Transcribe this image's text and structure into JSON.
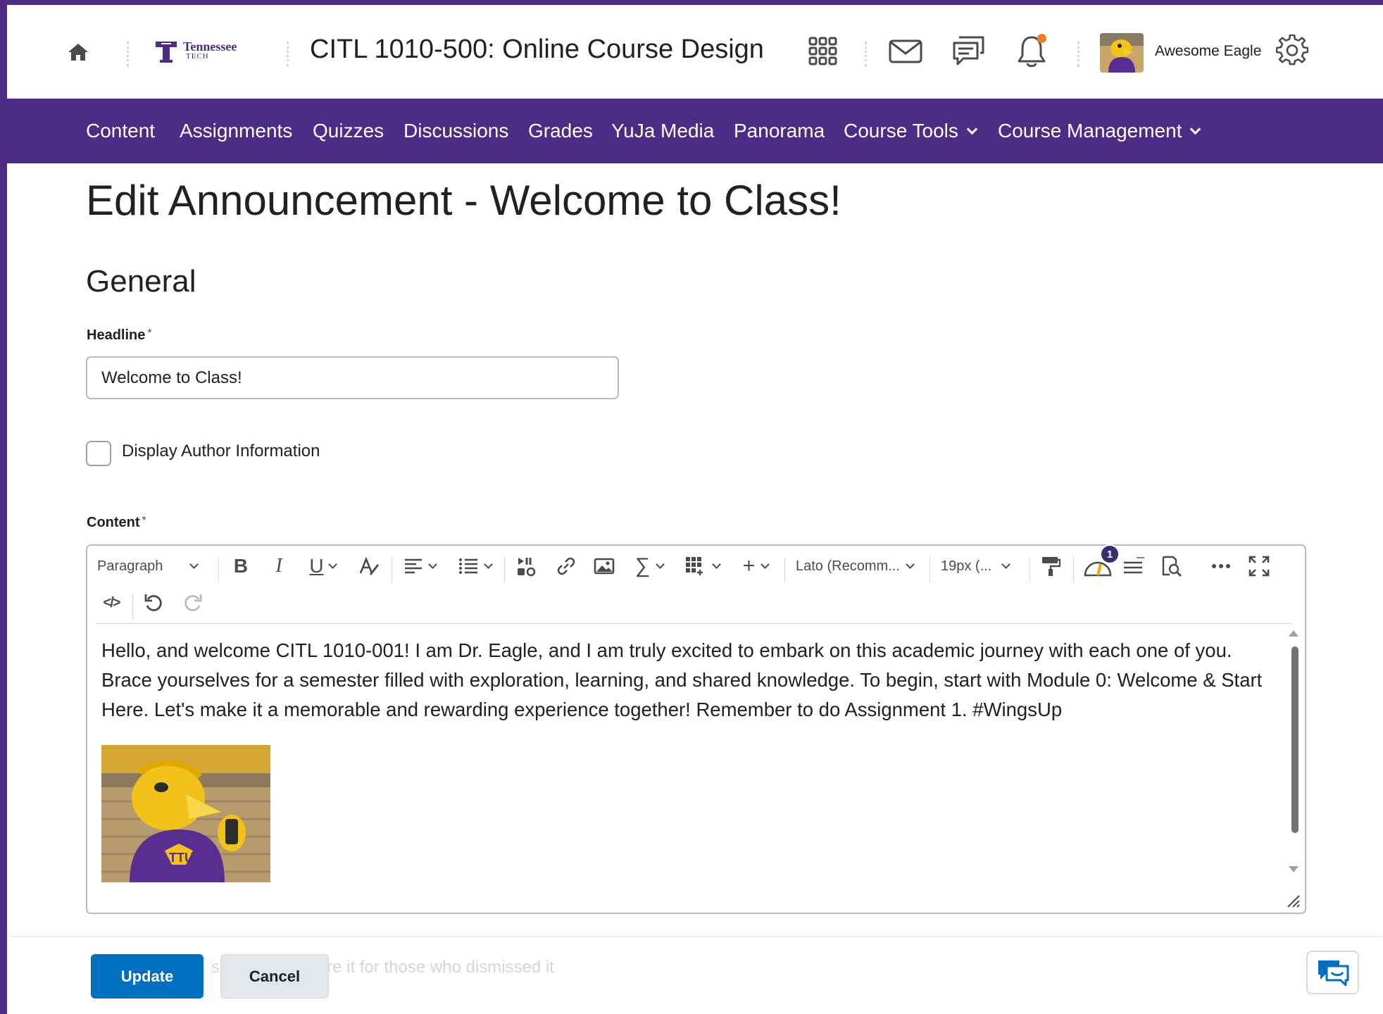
{
  "header": {
    "home_icon": "home-icon",
    "logo_text_line1": "Tennessee",
    "logo_text_line2": "TECH",
    "course_title": "CITL 1010-500: Online Course Design",
    "icons": [
      "waffle-grid-icon",
      "mail-icon",
      "chat-bubbles-icon",
      "bell-icon",
      "gear-icon"
    ],
    "user_name": "Awesome Eagle",
    "notification_dot_color": "#f18024"
  },
  "nav": {
    "items": [
      {
        "label": "Content"
      },
      {
        "label": "Assignments"
      },
      {
        "label": "Quizzes"
      },
      {
        "label": "Discussions"
      },
      {
        "label": "Grades"
      },
      {
        "label": "YuJa Media"
      },
      {
        "label": "Panorama"
      },
      {
        "label": "Course Tools"
      },
      {
        "label": "Course Management"
      }
    ],
    "background_color": "#4c2c84"
  },
  "page": {
    "title": "Edit Announcement - Welcome to Class!",
    "section_title": "General"
  },
  "form": {
    "headline_label": "Headline",
    "required_mark": "*",
    "headline_value": "Welcome to Class!",
    "display_author_label": "Display Author Information",
    "display_author_checked": false,
    "content_label": "Content"
  },
  "editor": {
    "toolbar": {
      "block_format": "Paragraph",
      "font_family": "Lato (Recomm...",
      "font_size": "19px (...",
      "accessibility_badge": "1"
    },
    "body_text": "Hello, and welcome CITL 1010-001! I am Dr. Eagle, and I am truly excited to embark on this academic journey with each one of you. Brace yourselves for a semester filled with exploration, learning, and shared knowledge. To begin, start with Module 0: Welcome & Start Here. Let's make it a memorable and rewarding experience together! Remember to do Assignment 1. #WingsUp"
  },
  "footer": {
    "update_label": "Update",
    "cancel_label": "Cancel",
    "ghost_text": "s                              tion and restore it for those who dismissed it",
    "primary_color": "#006fbf"
  }
}
